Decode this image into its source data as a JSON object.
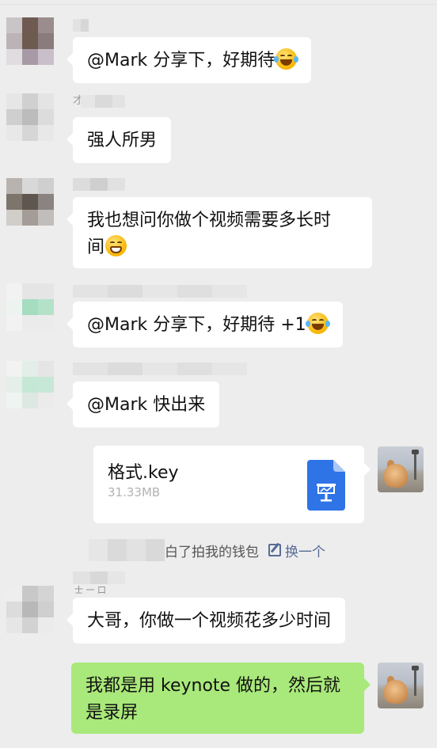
{
  "messages": {
    "m1": {
      "text": "@Mark 分享下，好期待",
      "emoji": "tears-of-joy"
    },
    "m2": {
      "name_fragment": "才",
      "text": "强人所男"
    },
    "m3": {
      "line1": "我也想问你做个视频需要多长时",
      "line2": "间",
      "emoji": "grimace"
    },
    "m4": {
      "text": "@Mark 分享下，好期待 +1",
      "emoji": "tears-of-joy"
    },
    "m5": {
      "text": "@Mark 快出来"
    },
    "file": {
      "name": "格式.key",
      "size": "31.33MB",
      "icon": "keynote-file-icon"
    },
    "system": {
      "text": "拍了拍我的钱包",
      "text_partial": "白了拍我的钱包",
      "link": "换一个"
    },
    "m6": {
      "name_fragment": "士 一 口",
      "text": "大哥，你做一个视频花多少时间"
    },
    "m7": {
      "line1": "我都是用 keynote 做的，然后就",
      "line2": "是录屏"
    }
  },
  "colors": {
    "background": "#ededed",
    "bubble_left": "#ffffff",
    "bubble_self": "#a9e87a",
    "link": "#576b95",
    "keynote_blue": "#2f74e6"
  }
}
